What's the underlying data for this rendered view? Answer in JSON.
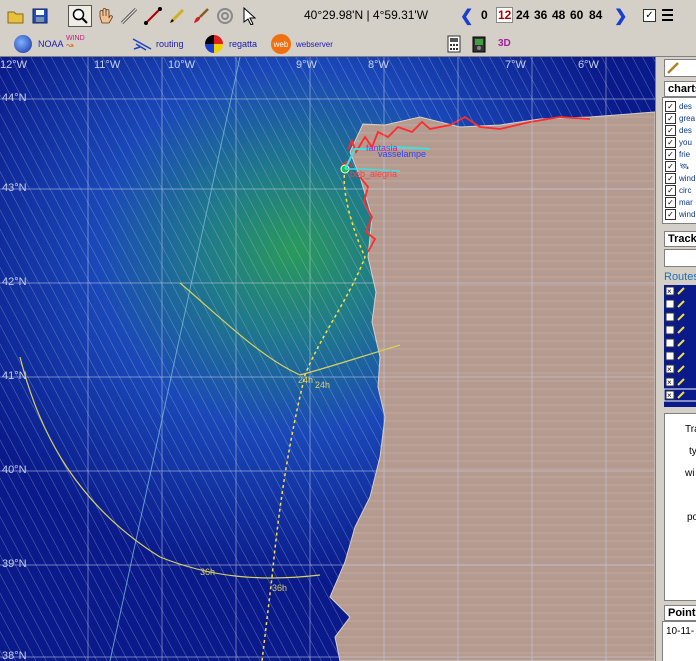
{
  "toolbar": {
    "cursor_coords": "40°29.98'N | 4°59.31'W",
    "hours": [
      "0",
      "12",
      "24",
      "36",
      "48",
      "60",
      "84"
    ],
    "selected_hour": "12",
    "three_d_label": "3D"
  },
  "toolbar2": {
    "noaa_label": "NOAA",
    "wind_label": "WIND",
    "routing_label": "routing",
    "regatta_label": "regatta",
    "web_label": "web",
    "webserver_label": "webserver"
  },
  "map": {
    "lon_labels": [
      "12°W",
      "11°W",
      "10°W",
      "9°W",
      "8°W",
      "7°W",
      "6°W"
    ],
    "lat_labels": [
      "44°N",
      "43°N",
      "42°N",
      "41°N",
      "40°N",
      "39°N",
      "38°N"
    ],
    "boats": [
      "fantasia",
      "vasselampe",
      "bob_alegria"
    ],
    "isochrone_labels": [
      "24h",
      "24h",
      "36h",
      "36h"
    ]
  },
  "panel": {
    "charts_tab": "charts",
    "chart_layers": [
      "des",
      "grea",
      "des",
      "you",
      "frie",
      "",
      "wind",
      "circ",
      "mar",
      "wind"
    ],
    "tracks_tab": "Track",
    "routes_label": "Routes",
    "track_fields": [
      "Tra",
      "ty",
      "wi",
      "",
      "po"
    ],
    "points_tab": "Points",
    "points_date": "10-11-"
  },
  "colors": {
    "sea_deep": "#0a1a8a",
    "wind_line": "#9fb0d8",
    "land": "#b59a90",
    "isochrone": "#d8d060",
    "route": "#ffe040",
    "coast_red": "#ff2a2a"
  }
}
